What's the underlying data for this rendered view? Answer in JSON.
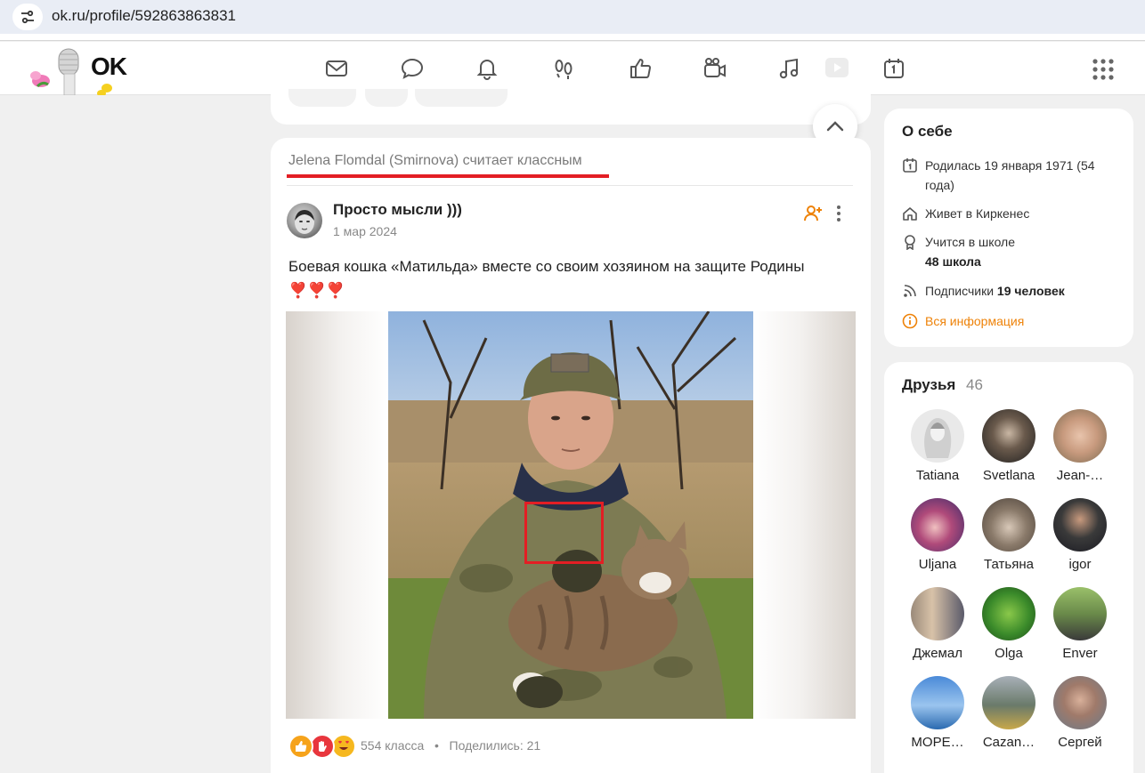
{
  "browser": {
    "url": "ok.ru/profile/592863863831"
  },
  "header": {
    "logo_text": "OK",
    "nav_icons": [
      "mail-icon",
      "chat-icon",
      "bell-icon",
      "footprints-icon",
      "like-icon",
      "video-camera-icon",
      "music-icon",
      "play-icon",
      "calendar-icon"
    ],
    "apps_icon": "apps-grid-icon"
  },
  "post": {
    "liked_by": "Jelena Flomdal (Smirnova) считает классным",
    "group_name": "Просто мысли )))",
    "date": "1 мар 2024",
    "text": "Боевая кошка «Матильда»  вместе со своим хозяином на защите Родины ❣️❣️❣️",
    "likes": "554 класса",
    "separator": "•",
    "shares": "Поделились: 21",
    "reactions": [
      "thumbs-up-reaction",
      "hand-reaction",
      "heart-eyes-reaction"
    ]
  },
  "about": {
    "title": "О себе",
    "born": "Родилась 19 января 1971 (54 года)",
    "lives": "Живет в Киркенес",
    "school_label": "Учится в школе",
    "school_name": "48 школа",
    "subscribers_label": "Подписчики",
    "subscribers_count": "19 человек",
    "all_info": "Вся информация"
  },
  "friends": {
    "title": "Друзья",
    "count": "46",
    "list": [
      {
        "name": "Tatiana"
      },
      {
        "name": "Svetlana"
      },
      {
        "name": "Jean-…"
      },
      {
        "name": "Uljana"
      },
      {
        "name": "Татьяна"
      },
      {
        "name": "igor"
      },
      {
        "name": "Джемал"
      },
      {
        "name": "Olga"
      },
      {
        "name": "Enver"
      },
      {
        "name": "МОРЕ…"
      },
      {
        "name": "Cazan…"
      },
      {
        "name": "Сергей"
      }
    ]
  },
  "colors": {
    "accent_orange": "#ee8208",
    "annotation_red": "#e31e24"
  }
}
